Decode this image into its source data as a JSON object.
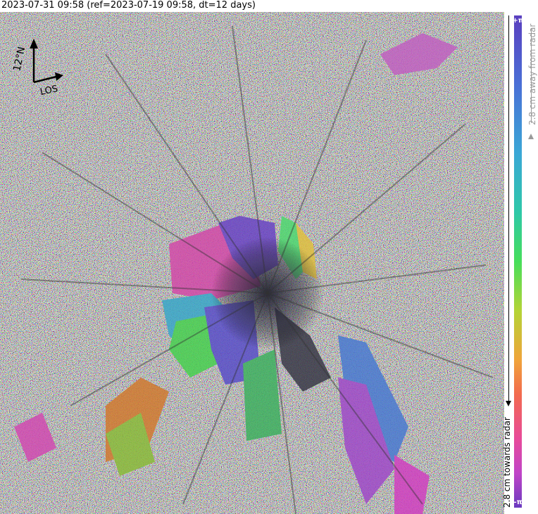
{
  "title": "2023-07-31 09:58 (ref=2023-07-19 09:58, dt=12 days)",
  "compass": {
    "north_label": "12°N",
    "los_label": "LOS",
    "icon": "compass-arrows-icon"
  },
  "colorbar": {
    "top_label": "+π",
    "bottom_label": "-π",
    "away_label": "2.8 cm away from radar",
    "towards_label": "2.8 cm towards radar",
    "colors": [
      "#5a3fbf",
      "#3aa7d6",
      "#46de5a",
      "#f0a43a",
      "#e84a9a",
      "#6a3abf"
    ]
  }
}
